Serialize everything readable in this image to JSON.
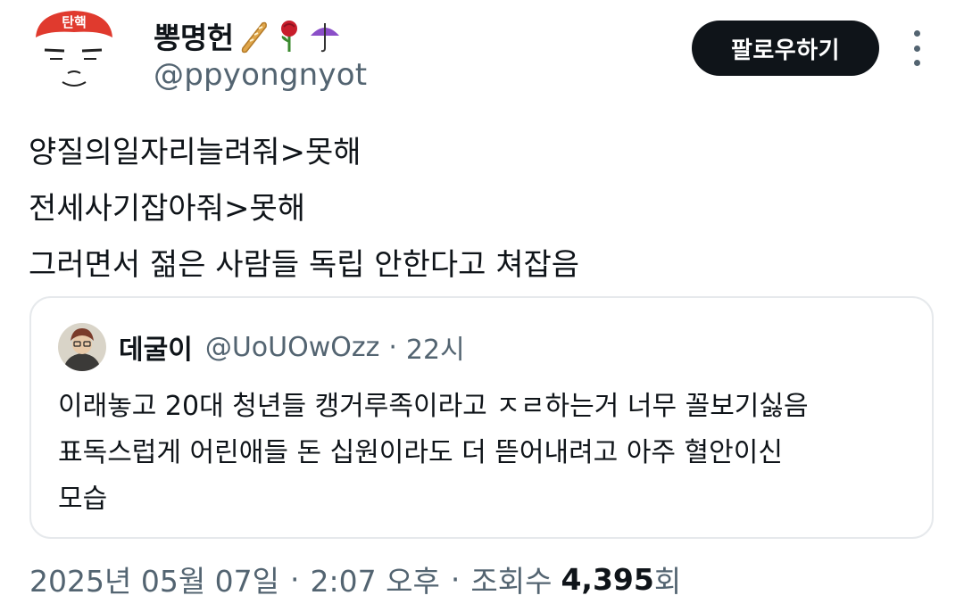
{
  "author": {
    "name": "뽕명헌",
    "handle": "@ppyongnyot",
    "avatar_headband_text": "탄핵",
    "name_emojis": [
      "baguette-emoji",
      "rose-emoji",
      "umbrella-emoji"
    ]
  },
  "follow_button_label": "팔로우하기",
  "more_icon": "more-vertical-icon",
  "tweet": {
    "lines": [
      "양질의일자리늘려줘>못해",
      "전세사기잡아줘>못해",
      "그러면서 젊은 사람들 독립 안한다고 쳐잡음"
    ]
  },
  "quote": {
    "name": "데굴이",
    "handle": "@UoUOwOzz",
    "separator": "·",
    "time": "22시",
    "lines": [
      "이래놓고 20대 청년들 캥거루족이라고 ㅈㄹ하는거 너무 꼴보기싫음",
      "표독스럽게 어린애들 돈 십원이라도 더 뜯어내려고 아주 혈안이신",
      "모습"
    ]
  },
  "meta": {
    "date": "2025년 05월 07일",
    "separator1": "·",
    "time": "2:07 오후",
    "separator2": "·",
    "views_label": "조회수",
    "views_count": "4,395",
    "views_suffix": "회"
  },
  "colors": {
    "text_primary": "#0f1419",
    "text_secondary": "#536471",
    "border": "#e6e9ec",
    "button_bg": "#0f1419",
    "avatar_headband": "#e03a2e"
  }
}
